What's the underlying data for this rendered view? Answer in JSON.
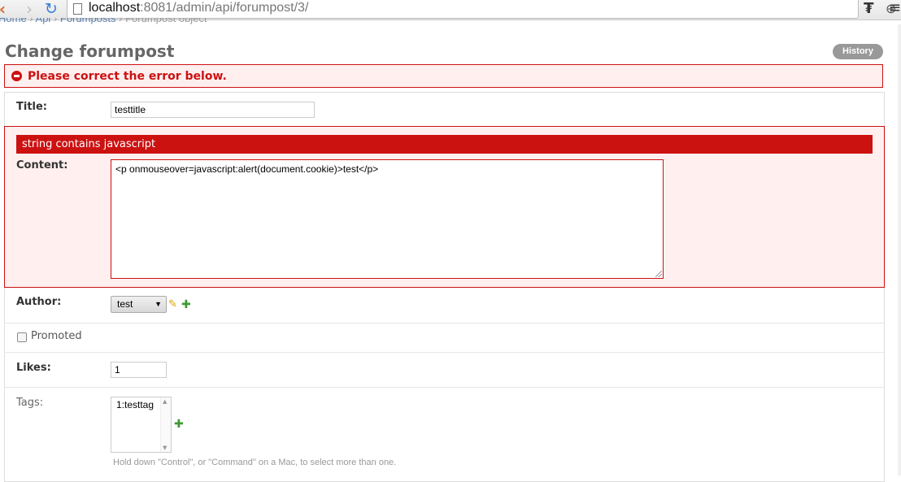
{
  "browser": {
    "url_host": "localhost",
    "url_rest": ":8081/admin/api/forumpost/3/",
    "back_glyph": "‹",
    "forward_glyph": "›",
    "reload_glyph": "↻",
    "star_glyph": "☆",
    "zoom_glyph": "⊕",
    "ext_glyph": "₮",
    "menu_glyph": "≡"
  },
  "breadcrumb": {
    "home": "Home",
    "sep": " › ",
    "app": "Api",
    "model": "Forumposts",
    "current": "Forumpost object"
  },
  "page": {
    "title": "Change forumpost",
    "history_label": "History",
    "error_note": "Please correct the error below."
  },
  "fields": {
    "title": {
      "label": "Title:",
      "value": "testtitle"
    },
    "content": {
      "label": "Content:",
      "error": "string contains javascript",
      "value": "<p onmouseover=javascript:alert(document.cookie)>test</p>"
    },
    "author": {
      "label": "Author:",
      "selected": "test",
      "arrow": "▼"
    },
    "promoted": {
      "label": "Promoted"
    },
    "likes": {
      "label": "Likes:",
      "value": "1"
    },
    "tags": {
      "label": "Tags:",
      "options": [
        "1:testtag"
      ],
      "help": "Hold down \"Control\", or \"Command\" on a Mac, to select more than one."
    }
  },
  "icons": {
    "pencil": "✎",
    "plus": "✚",
    "up": "▲",
    "down": "▼"
  },
  "colors": {
    "error_red": "#cc1111",
    "error_bg": "#ffefef",
    "link_blue": "#5b80b2"
  }
}
